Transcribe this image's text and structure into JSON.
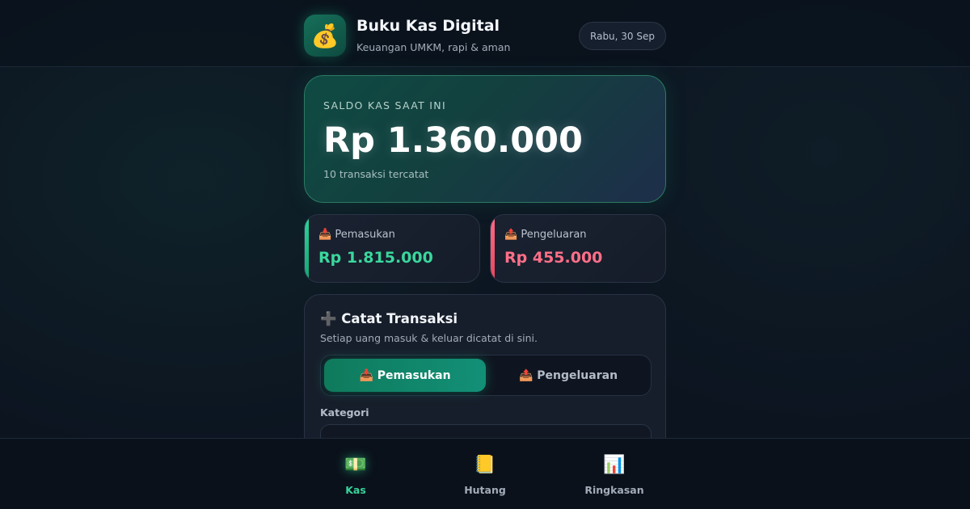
{
  "header": {
    "logo_icon": "money-bag-icon",
    "logo_glyph": "💰",
    "title": "Buku Kas Digital",
    "subtitle": "Keuangan UMKM, rapi & aman",
    "date": "Rabu, 30 Sep"
  },
  "balance": {
    "label": "SALDO KAS SAAT INI",
    "value": "Rp 1.360.000",
    "count_text": "10 transaksi tercatat"
  },
  "summary": {
    "income": {
      "icon": "inbox-tray-icon",
      "label": "📥 Pemasukan",
      "value": "Rp 1.815.000",
      "color": "#3ad79d"
    },
    "expense": {
      "icon": "outbox-tray-icon",
      "label": "📤 Pengeluaran",
      "value": "Rp 455.000",
      "color": "#ff6f88"
    }
  },
  "form": {
    "title": "➕ Catat Transaksi",
    "subtitle": "Setiap uang masuk & keluar dicatat di sini.",
    "segment": {
      "active": "📥 Pemasukan",
      "inactive": "📤 Pengeluaran"
    },
    "category_label": "Kategori",
    "category_value": ""
  },
  "nav": {
    "items": [
      {
        "icon": "💵",
        "icon_name": "banknote-icon",
        "label": "Kas",
        "active": true
      },
      {
        "icon": "📒",
        "icon_name": "ledger-icon",
        "label": "Hutang",
        "active": false
      },
      {
        "icon": "📊",
        "icon_name": "bar-chart-icon",
        "label": "Ringkasan",
        "active": false
      }
    ]
  },
  "colors": {
    "accent": "#129077",
    "income": "#3ad79d",
    "expense": "#ff6f88",
    "background": "#0c1420"
  }
}
